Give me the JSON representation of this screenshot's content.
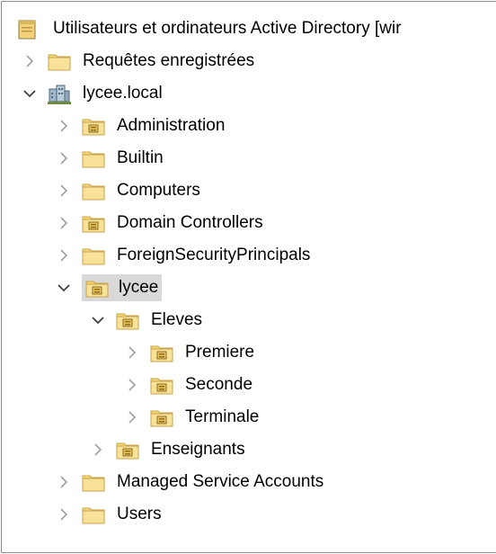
{
  "root": {
    "label": "Utilisateurs et ordinateurs Active Directory [wir",
    "icon": "ad-snapin-icon"
  },
  "items": [
    {
      "label": "Requêtes enregistrées",
      "icon": "folder-icon",
      "state": "collapsed"
    },
    {
      "label": "lycee.local",
      "icon": "domain-icon",
      "state": "expanded"
    },
    {
      "label": "Administration",
      "icon": "ou-icon",
      "state": "collapsed"
    },
    {
      "label": "Builtin",
      "icon": "folder-icon",
      "state": "collapsed"
    },
    {
      "label": "Computers",
      "icon": "folder-icon",
      "state": "collapsed"
    },
    {
      "label": "Domain Controllers",
      "icon": "ou-icon",
      "state": "collapsed"
    },
    {
      "label": "ForeignSecurityPrincipals",
      "icon": "folder-icon",
      "state": "collapsed"
    },
    {
      "label": "lycee",
      "icon": "ou-icon",
      "state": "expanded",
      "selected": true
    },
    {
      "label": "Eleves",
      "icon": "ou-icon",
      "state": "expanded"
    },
    {
      "label": "Premiere",
      "icon": "ou-icon",
      "state": "collapsed"
    },
    {
      "label": "Seconde",
      "icon": "ou-icon",
      "state": "collapsed"
    },
    {
      "label": "Terminale",
      "icon": "ou-icon",
      "state": "collapsed"
    },
    {
      "label": "Enseignants",
      "icon": "ou-icon",
      "state": "collapsed"
    },
    {
      "label": "Managed Service Accounts",
      "icon": "folder-icon",
      "state": "collapsed"
    },
    {
      "label": "Users",
      "icon": "folder-icon",
      "state": "collapsed"
    }
  ],
  "colors": {
    "folder_fill": "#f5d77a",
    "folder_border": "#c9a44a",
    "selection": "#d9d9d9",
    "chevron_collapsed": "#a0a0a0",
    "chevron_expanded": "#404040"
  }
}
